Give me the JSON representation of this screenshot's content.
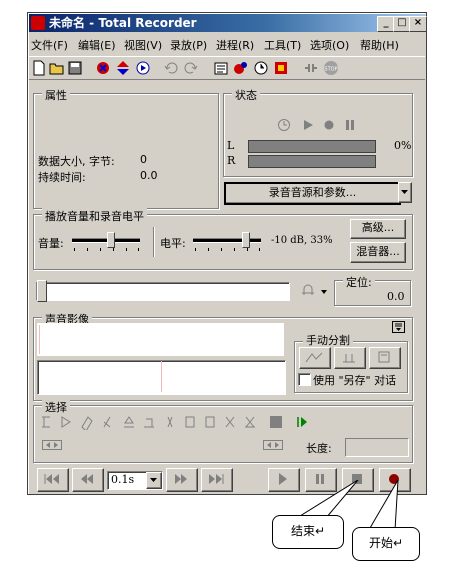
{
  "window": {
    "title": "未命名 - Total Recorder"
  },
  "menu": [
    "文件(F)",
    "编辑(E)",
    "视图(V)",
    "录放(P)",
    "进程(R)",
    "工具(T)",
    "选项(O)",
    "帮助(H)"
  ],
  "toolbar_icons": [
    "new-file-icon",
    "open-folder-icon",
    "save-icon",
    "record-source-icon",
    "convert-icon",
    "schedule-icon",
    "undo-icon",
    "redo-icon",
    "properties-icon",
    "effects-icon",
    "timer-icon",
    "split-icon",
    "trim-icon",
    "stop-icon"
  ],
  "properties": {
    "title": "属性",
    "size_label": "数据大小, 字节:",
    "size_value": "0",
    "duration_label": "持续时间:",
    "duration_value": "0.0"
  },
  "status": {
    "title": "状态",
    "left_channel": "L",
    "right_channel": "R",
    "percent": "0%",
    "left_level": 0,
    "right_level": 0
  },
  "source_button": "录音音源和参数...",
  "levels": {
    "title": "播放音量和录音电平",
    "volume_label": "音量:",
    "level_label": "电平:",
    "level_readout": "-10 dB, 33%",
    "advanced_button": "高级...",
    "mixer_button": "混音器..."
  },
  "position": {
    "label": "定位:",
    "value": "0.0"
  },
  "waveform": {
    "title": "声音影像"
  },
  "manual_split": {
    "title": "手动分割",
    "save_as_label": "使用 \"另存\" 对话"
  },
  "selection": {
    "title": "选择",
    "length_label": "长度:"
  },
  "transport": {
    "step_value": "0.1s"
  },
  "callouts": {
    "stop": "结束↵",
    "start": "开始↵"
  }
}
